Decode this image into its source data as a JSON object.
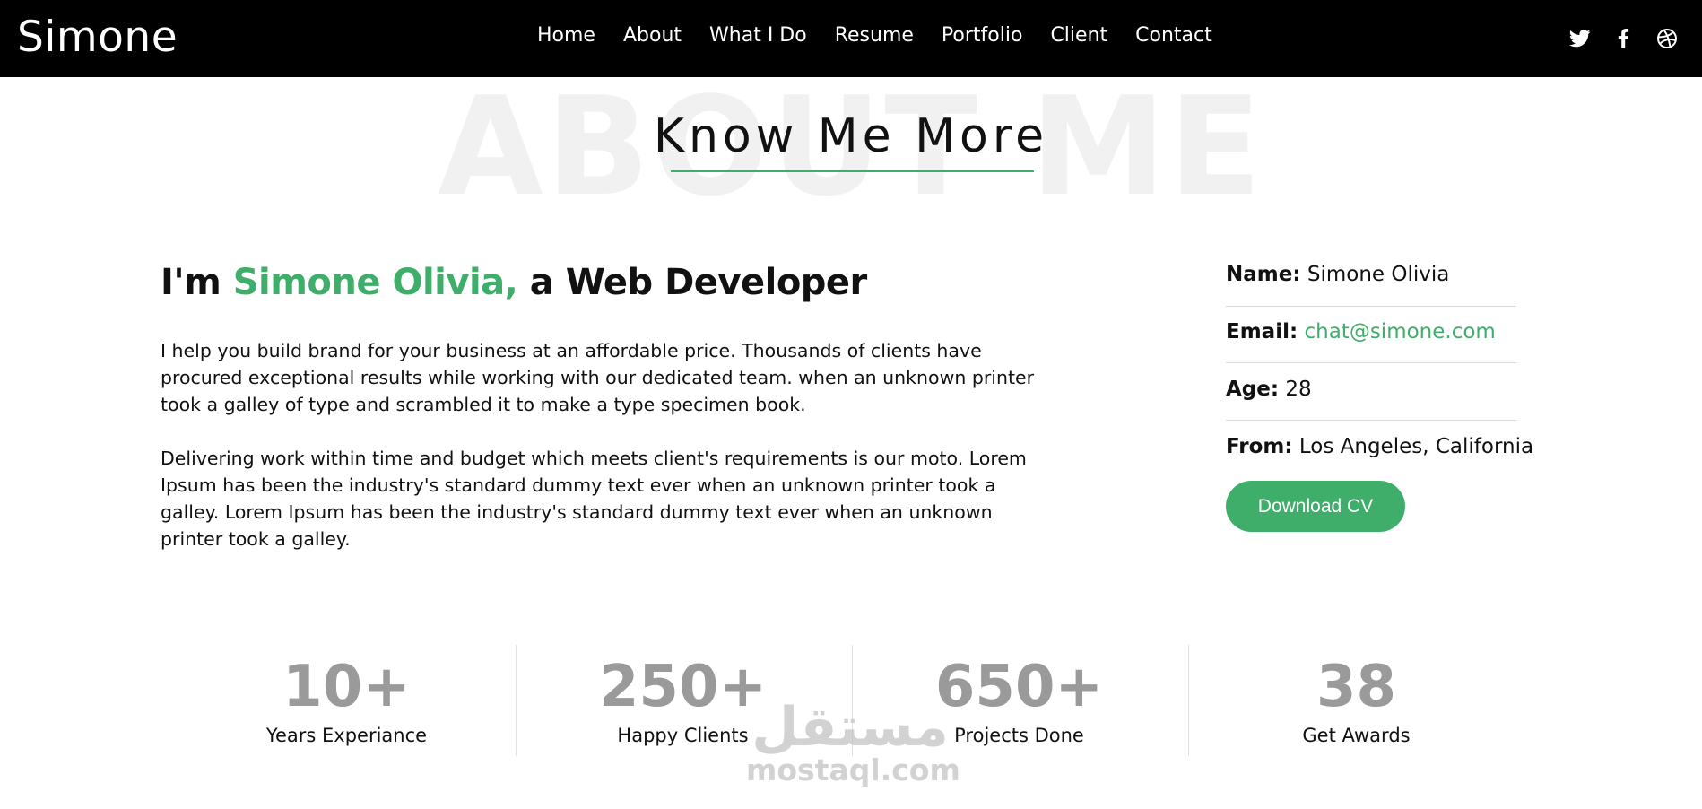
{
  "nav": {
    "brand": "Simone",
    "links": [
      "Home",
      "About",
      "What I Do",
      "Resume",
      "Portfolio",
      "Client",
      "Contact"
    ],
    "social_icons": [
      "twitter-icon",
      "facebook-icon",
      "dribbble-icon"
    ]
  },
  "section": {
    "background_word": "ABOUT ME",
    "title": "Know Me More"
  },
  "intro": {
    "prefix": "I'm ",
    "name": "Simone Olivia,",
    "suffix": " a Web Developer"
  },
  "paragraphs": [
    "I help you build brand for your business at an affordable price. Thousands of clients have procured exceptional results while working with our dedicated team. when an unknown printer took a galley of type and scrambled it to make a type specimen book.",
    "Delivering work within time and budget which meets client's requirements is our moto. Lorem Ipsum has been the industry's standard dummy text ever when an unknown printer took a galley. Lorem Ipsum has been the industry's standard dummy text ever when an unknown printer took a galley."
  ],
  "info": {
    "name_label": "Name:",
    "name_value": "Simone Olivia",
    "email_label": "Email:",
    "email_value": "chat@simone.com",
    "age_label": "Age:",
    "age_value": "28",
    "from_label": "From:",
    "from_value": "Los Angeles, California",
    "download_label": "Download CV"
  },
  "stats": [
    {
      "value": "10+",
      "label": "Years Experiance"
    },
    {
      "value": "250+",
      "label": "Happy Clients"
    },
    {
      "value": "650+",
      "label": "Projects Done"
    },
    {
      "value": "38",
      "label": "Get Awards"
    }
  ],
  "watermark": {
    "arabic": "مستقل",
    "latin": "mostaql.com"
  },
  "colors": {
    "accent": "#3fae6a",
    "nav_bg": "#000000",
    "stat_number": "#9a9a9a"
  }
}
